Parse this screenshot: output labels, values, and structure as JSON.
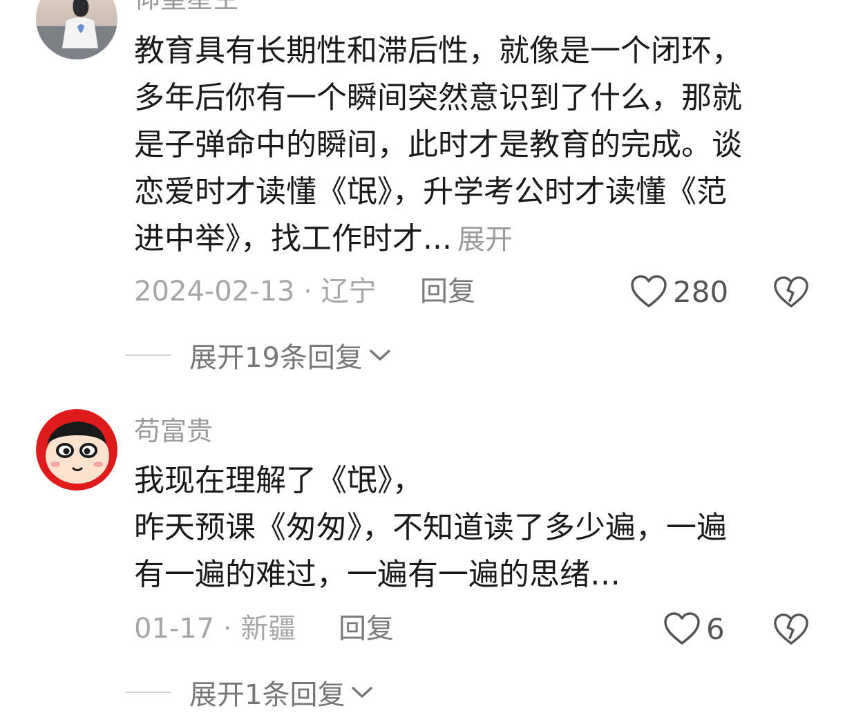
{
  "comments": [
    {
      "username": "仰望星空",
      "lines": [
        "教育具有长期性和滞后性，就像是一个闭环，",
        "多年后你有一个瞬间突然意识到了什么，那就",
        "是子弹命中的瞬间，此时才是教育的完成。谈",
        "恋爱时才读懂《氓》，升学考公时才读懂《范",
        "进中举》，找工作时才..."
      ],
      "expand_label": "展开",
      "date": "2024-02-13",
      "separator": " · ",
      "location": "辽宁",
      "reply_label": "回复",
      "likes": "280",
      "replies_label": "展开19条回复",
      "like_icon": "heart-outline-icon",
      "dislike_icon": "broken-heart-icon"
    },
    {
      "username": "苟富贵",
      "lines": [
        "我现在理解了《氓》，",
        "昨天预课《匆匆》，不知道读了多少遍，一遍",
        "有一遍的难过，一遍有一遍的思绪…"
      ],
      "date": "01-17",
      "separator": " · ",
      "location": "新疆",
      "reply_label": "回复",
      "likes": "6",
      "replies_label": "展开1条回复",
      "like_icon": "heart-outline-icon",
      "dislike_icon": "broken-heart-icon"
    }
  ],
  "colors": {
    "text_primary": "#1a1a1a",
    "text_secondary": "#9a9a9a",
    "background": "#ffffff"
  }
}
